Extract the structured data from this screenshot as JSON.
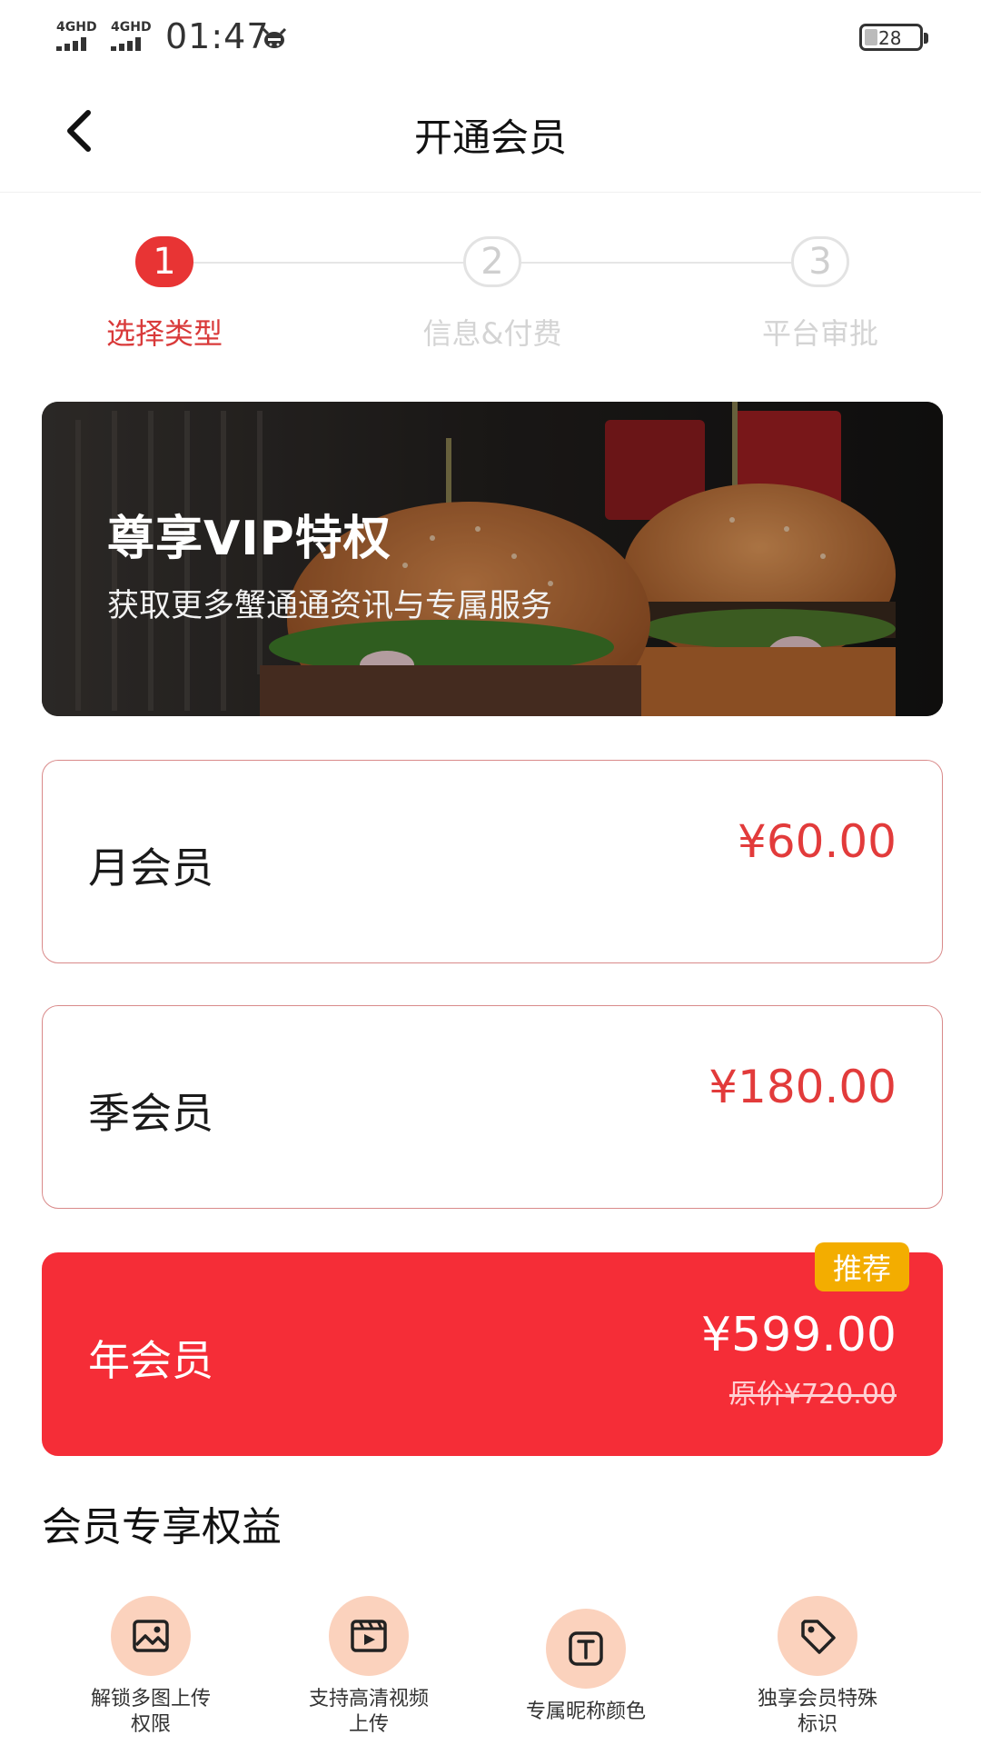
{
  "status_bar": {
    "network_1": "4GHD",
    "network_2": "4GHD",
    "time": "01:47",
    "battery": "28"
  },
  "nav": {
    "title": "开通会员",
    "back_icon": "chevron-left-icon"
  },
  "steps": [
    {
      "number": "1",
      "label": "选择类型",
      "active": true
    },
    {
      "number": "2",
      "label": "信息&付费",
      "active": false
    },
    {
      "number": "3",
      "label": "平台审批",
      "active": false
    }
  ],
  "banner": {
    "title": "尊享VIP特权",
    "subtitle": "获取更多蟹通通资讯与专属服务"
  },
  "plans": [
    {
      "name": "月会员",
      "price": "¥60.00"
    },
    {
      "name": "季会员",
      "price": "¥180.00"
    },
    {
      "name": "年会员",
      "price": "¥599.00",
      "original_price": "原价¥720.00",
      "badge": "推荐",
      "selected": true
    }
  ],
  "benefits": {
    "title": "会员专享权益",
    "items": [
      {
        "icon": "image-icon",
        "label_1": "解锁多图上传",
        "label_2": "权限"
      },
      {
        "icon": "video-icon",
        "label_1": "支持高清视频",
        "label_2": "上传"
      },
      {
        "icon": "text-icon",
        "label_1": "专属昵称颜色",
        "label_2": ""
      },
      {
        "icon": "tag-icon",
        "label_1": "独享会员特殊",
        "label_2": "标识"
      }
    ]
  },
  "colors": {
    "accent": "#f52d37",
    "price_red": "#e23b3b",
    "badge": "#f3ad00",
    "benefit_circle": "#fbd2bd"
  }
}
